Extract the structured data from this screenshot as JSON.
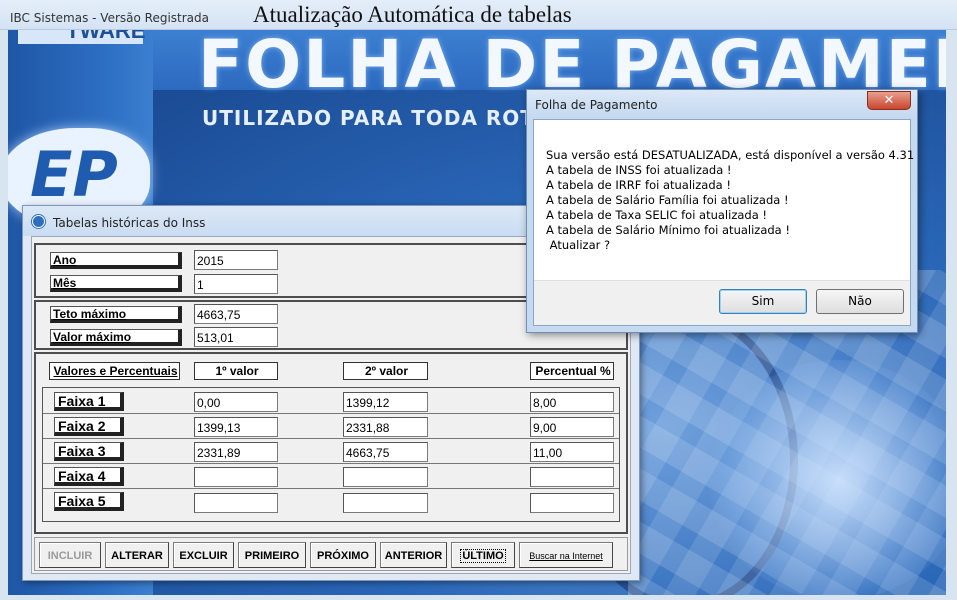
{
  "app": {
    "window_title": "IBC Sistemas - Versão Registrada",
    "header": "Atualização Automática de tabelas",
    "background": {
      "big_title": "FOLHA DE PAGAMEN",
      "subtitle": "UTILIZADO PARA TODA ROTINA",
      "top_strip": "TWARE",
      "logo": "EP"
    }
  },
  "inss_window": {
    "title": "Tabelas históricas do Inss",
    "ano_label": "Ano",
    "ano_value": "2015",
    "mes_label": "Mês",
    "mes_value": "1",
    "teto_label": "Teto máximo",
    "teto_value": "4663,75",
    "valor_label": "Valor máximo",
    "valor_value": "513,01",
    "columns": {
      "valores": "Valores e Percentuais",
      "v1": "1º valor",
      "v2": "2º valor",
      "pct": "Percentual %"
    },
    "faixas": [
      {
        "label": "Faixa 1",
        "v1": "0,00",
        "v2": "1399,12",
        "pct": "8,00"
      },
      {
        "label": "Faixa 2",
        "v1": "1399,13",
        "v2": "2331,88",
        "pct": "9,00"
      },
      {
        "label": "Faixa 3",
        "v1": "2331,89",
        "v2": "4663,75",
        "pct": "11,00"
      },
      {
        "label": "Faixa 4",
        "v1": "",
        "v2": "",
        "pct": ""
      },
      {
        "label": "Faixa 5",
        "v1": "",
        "v2": "",
        "pct": ""
      }
    ],
    "buttons": {
      "incluir": "INCLUIR",
      "alterar": "ALTERAR",
      "excluir": "EXCLUIR",
      "primeiro": "PRIMEIRO",
      "proximo": "PRÓXIMO",
      "anterior": "ANTERIOR",
      "ultimo": "ÚLTIMO",
      "buscar": "Buscar na Internet"
    }
  },
  "dialog": {
    "title": "Folha de Pagamento",
    "close_glyph": "✕",
    "lines": [
      "Sua versão está DESATUALIZADA, está disponível a versão 4.31",
      "A tabela de INSS foi atualizada !",
      "A tabela de IRRF foi atualizada !",
      "A tabela de Salário Família foi atualizada !",
      "A tabela de Taxa SELIC foi atualizada !",
      "A tabela de Salário Mínimo foi atualizada !",
      " Atualizar ?"
    ],
    "yes_label": "Sim",
    "no_label": "Não"
  }
}
